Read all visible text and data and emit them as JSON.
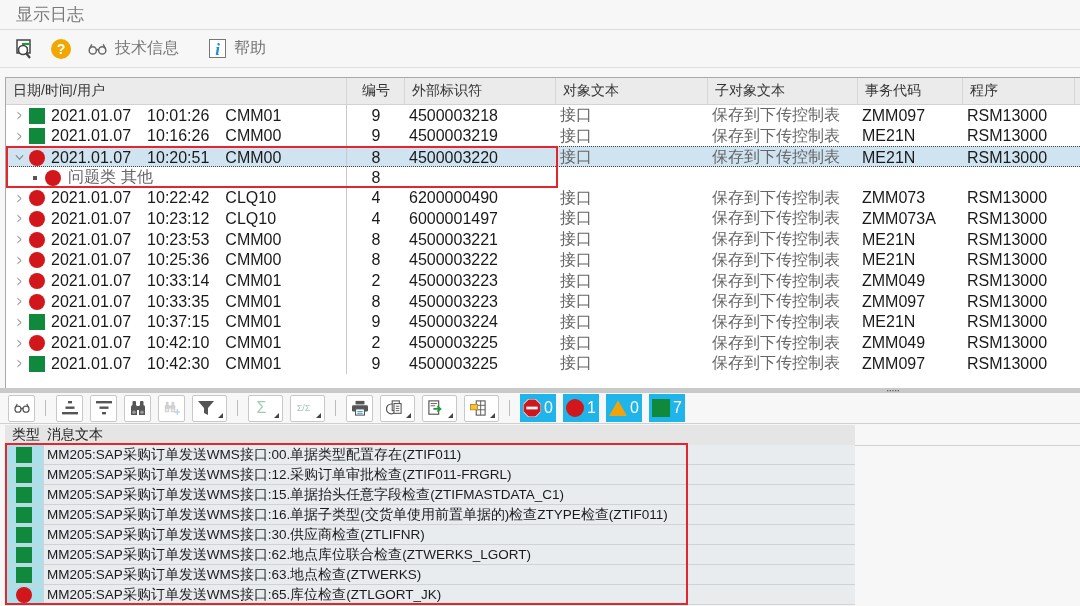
{
  "title": "显示日志",
  "toolbar": [
    {
      "kind": "detail"
    },
    {
      "kind": "help",
      "symbol": "?"
    },
    {
      "kind": "technical-info",
      "label": "技术信息"
    },
    {
      "kind": "info",
      "symbol": "i",
      "label": "帮助"
    }
  ],
  "log_table": {
    "columns": [
      "日期/时间/用户",
      "编号",
      "外部标识符",
      "对象文本",
      "子对象文本",
      "事务代码",
      "程序"
    ],
    "rows": [
      {
        "kind": "success",
        "expanded": false,
        "selected": false,
        "highlighted": false,
        "date": "2021.01.07",
        "time": "10:01:26",
        "user": "CMM01",
        "number": "9",
        "external_id": "4500003218",
        "object_text": "接口",
        "subobject_text": "保存到下传控制表",
        "transaction": "ZMM097",
        "program": "RSM13000"
      },
      {
        "kind": "success",
        "expanded": false,
        "selected": false,
        "highlighted": false,
        "date": "2021.01.07",
        "time": "10:16:26",
        "user": "CMM00",
        "number": "9",
        "external_id": "4500003219",
        "object_text": "接口",
        "subobject_text": "保存到下传控制表",
        "transaction": "ME21N",
        "program": "RSM13000"
      },
      {
        "kind": "error",
        "expanded": true,
        "selected": true,
        "highlighted": true,
        "date": "2021.01.07",
        "time": "10:20:51",
        "user": "CMM00",
        "number": "8",
        "external_id": "4500003220",
        "object_text": "接口",
        "subobject_text": "保存到下传控制表",
        "transaction": "ME21N",
        "program": "RSM13000",
        "children": [
          {
            "kind": "error",
            "text": "问题类 其他",
            "number": "8"
          }
        ]
      },
      {
        "kind": "error",
        "expanded": false,
        "selected": false,
        "highlighted": false,
        "date": "2021.01.07",
        "time": "10:22:42",
        "user": "CLQ10",
        "number": "4",
        "external_id": "6200000490",
        "object_text": "接口",
        "subobject_text": "保存到下传控制表",
        "transaction": "ZMM073",
        "program": "RSM13000"
      },
      {
        "kind": "error",
        "expanded": false,
        "selected": false,
        "highlighted": false,
        "date": "2021.01.07",
        "time": "10:23:12",
        "user": "CLQ10",
        "number": "4",
        "external_id": "6000001497",
        "object_text": "接口",
        "subobject_text": "保存到下传控制表",
        "transaction": "ZMM073A",
        "program": "RSM13000"
      },
      {
        "kind": "error",
        "expanded": false,
        "selected": false,
        "highlighted": false,
        "date": "2021.01.07",
        "time": "10:23:53",
        "user": "CMM00",
        "number": "8",
        "external_id": "4500003221",
        "object_text": "接口",
        "subobject_text": "保存到下传控制表",
        "transaction": "ME21N",
        "program": "RSM13000"
      },
      {
        "kind": "error",
        "expanded": false,
        "selected": false,
        "highlighted": false,
        "date": "2021.01.07",
        "time": "10:25:36",
        "user": "CMM00",
        "number": "8",
        "external_id": "4500003222",
        "object_text": "接口",
        "subobject_text": "保存到下传控制表",
        "transaction": "ME21N",
        "program": "RSM13000"
      },
      {
        "kind": "error",
        "expanded": false,
        "selected": false,
        "highlighted": false,
        "date": "2021.01.07",
        "time": "10:33:14",
        "user": "CMM01",
        "number": "2",
        "external_id": "4500003223",
        "object_text": "接口",
        "subobject_text": "保存到下传控制表",
        "transaction": "ZMM049",
        "program": "RSM13000"
      },
      {
        "kind": "error",
        "expanded": false,
        "selected": false,
        "highlighted": false,
        "date": "2021.01.07",
        "time": "10:33:35",
        "user": "CMM01",
        "number": "8",
        "external_id": "4500003223",
        "object_text": "接口",
        "subobject_text": "保存到下传控制表",
        "transaction": "ZMM097",
        "program": "RSM13000"
      },
      {
        "kind": "success",
        "expanded": false,
        "selected": false,
        "highlighted": false,
        "date": "2021.01.07",
        "time": "10:37:15",
        "user": "CMM01",
        "number": "9",
        "external_id": "4500003224",
        "object_text": "接口",
        "subobject_text": "保存到下传控制表",
        "transaction": "ME21N",
        "program": "RSM13000"
      },
      {
        "kind": "error",
        "expanded": false,
        "selected": false,
        "highlighted": false,
        "date": "2021.01.07",
        "time": "10:42:10",
        "user": "CMM01",
        "number": "2",
        "external_id": "4500003225",
        "object_text": "接口",
        "subobject_text": "保存到下传控制表",
        "transaction": "ZMM049",
        "program": "RSM13000"
      },
      {
        "kind": "success",
        "expanded": false,
        "selected": false,
        "highlighted": false,
        "date": "2021.01.07",
        "time": "10:42:30",
        "user": "CMM01",
        "number": "9",
        "external_id": "4500003225",
        "object_text": "接口",
        "subobject_text": "保存到下传控制表",
        "transaction": "ZMM097",
        "program": "RSM13000"
      }
    ]
  },
  "message_toolbar": {
    "groups": [
      [
        {
          "kind": "glasses",
          "disabled": false,
          "dropdown": false
        }
      ],
      [
        {
          "kind": "sort-ascending",
          "disabled": false,
          "dropdown": false
        },
        {
          "kind": "sort-descending",
          "disabled": false,
          "dropdown": false
        },
        {
          "kind": "binoculars",
          "disabled": false,
          "dropdown": false
        },
        {
          "kind": "binoculars-plus",
          "disabled": true,
          "dropdown": false
        },
        {
          "kind": "filter",
          "disabled": false,
          "dropdown": true
        }
      ],
      [
        {
          "kind": "sum",
          "symbol": "Σ",
          "disabled": true,
          "dropdown": true
        },
        {
          "kind": "subtotal",
          "symbol": "Σ/Σ",
          "disabled": true,
          "dropdown": true
        }
      ],
      [
        {
          "kind": "printer",
          "disabled": false,
          "dropdown": false
        },
        {
          "kind": "export",
          "disabled": false,
          "dropdown": true
        },
        {
          "kind": "document-arrow",
          "disabled": false,
          "dropdown": true
        },
        {
          "kind": "layout",
          "disabled": false,
          "dropdown": true
        }
      ]
    ],
    "counts": [
      {
        "kind": "stop",
        "count": "0"
      },
      {
        "kind": "error",
        "count": "1"
      },
      {
        "kind": "warning",
        "count": "0"
      },
      {
        "kind": "success",
        "count": "7"
      }
    ]
  },
  "messages": {
    "columns": [
      "类型",
      "消息文本"
    ],
    "highlighted": true,
    "rows": [
      {
        "kind": "success",
        "text": "MM205:SAP采购订单发送WMS接口:00.单据类型配置存在(ZTIF011)"
      },
      {
        "kind": "success",
        "text": "MM205:SAP采购订单发送WMS接口:12.采购订单审批检查(ZTIF011-FRGRL)"
      },
      {
        "kind": "success",
        "text": "MM205:SAP采购订单发送WMS接口:15.单据抬头任意字段检查(ZTIFMASTDATA_C1)"
      },
      {
        "kind": "success",
        "text": "MM205:SAP采购订单发送WMS接口:16.单据子类型(交货单使用前置单据的)检查ZTYPE检查(ZTIF011)"
      },
      {
        "kind": "success",
        "text": "MM205:SAP采购订单发送WMS接口:30.供应商检查(ZTLIFNR)"
      },
      {
        "kind": "success",
        "text": "MM205:SAP采购订单发送WMS接口:62.地点库位联合检查(ZTWERKS_LGORT)"
      },
      {
        "kind": "success",
        "text": "MM205:SAP采购订单发送WMS接口:63.地点检查(ZTWERKS)"
      },
      {
        "kind": "error",
        "text": "MM205:SAP采购订单发送WMS接口:65.库位检查(ZTLGORT_JK)"
      }
    ]
  }
}
